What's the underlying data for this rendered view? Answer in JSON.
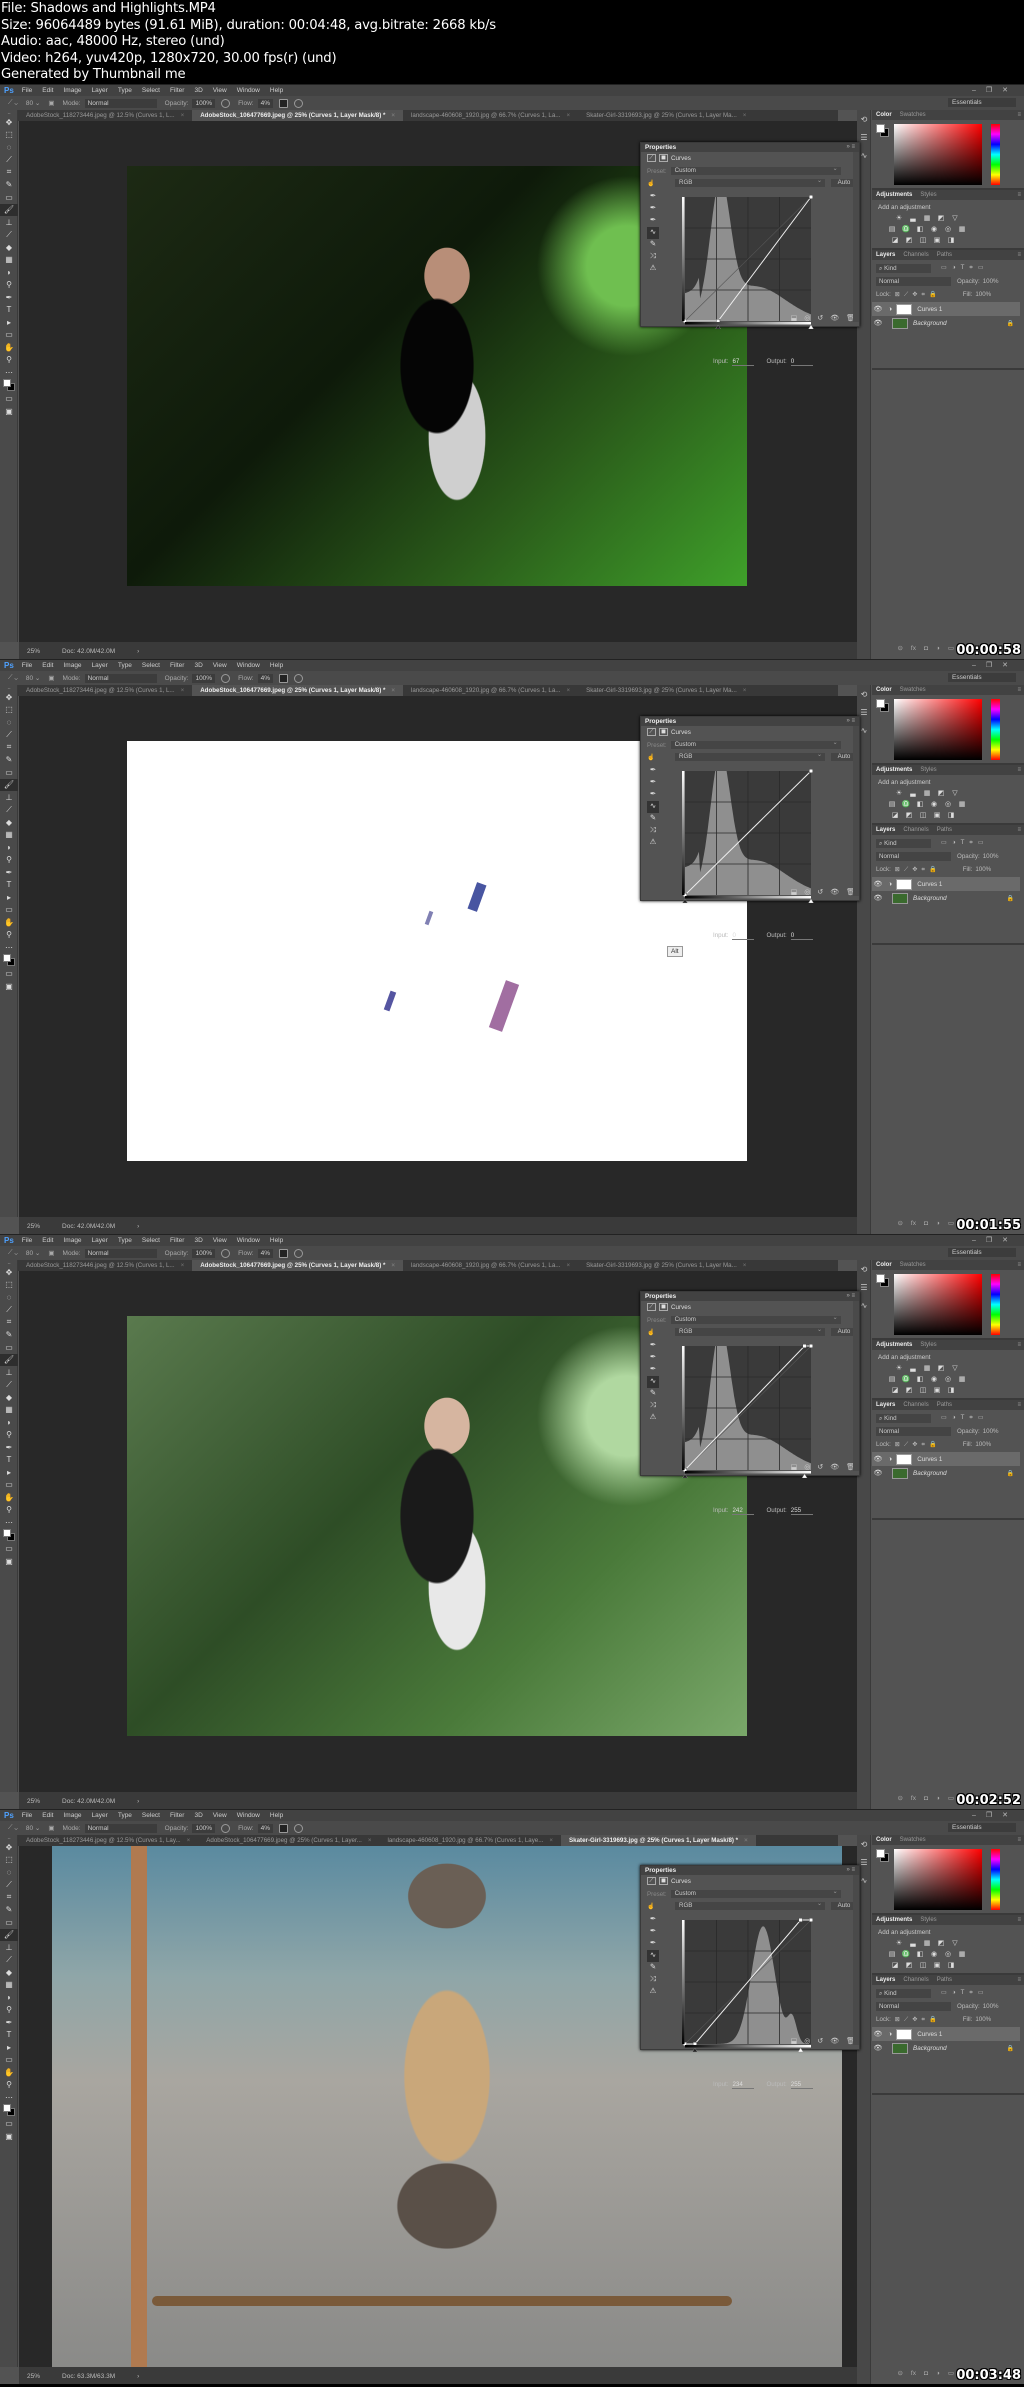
{
  "header": {
    "lines": [
      "File: Shadows and Highlights.MP4",
      "Size: 96064489 bytes (91.61 MiB), duration: 00:04:48, avg.bitrate: 2668 kb/s",
      "Audio: aac, 48000 Hz, stereo (und)",
      "Video: h264, yuv420p, 1280x720, 30.00 fps(r) (und)",
      "Generated by Thumbnail me"
    ]
  },
  "app": {
    "logo": "Ps",
    "menu": [
      "File",
      "Edit",
      "Image",
      "Layer",
      "Type",
      "Select",
      "Filter",
      "3D",
      "View",
      "Window",
      "Help"
    ],
    "window_controls": [
      "–",
      "❐",
      "✕"
    ],
    "workspace": "Essentials",
    "options": {
      "mode_label": "Mode:",
      "mode_value": "Normal",
      "opacity_label": "Opacity:",
      "opacity_value": "100%",
      "flow_label": "Flow:",
      "flow_value": "4%",
      "brush_size": "80"
    },
    "tools": [
      "✥",
      "⬚",
      "◌",
      "⟋",
      "⌗",
      "✎",
      "▭",
      "🖌",
      "⊥",
      "⟋",
      "◆",
      "▦",
      "◗",
      "⚲",
      "✒",
      "T",
      "▸",
      "▭",
      "✋",
      "⚲",
      "⋯"
    ],
    "color_panel": {
      "tabs": [
        "Color",
        "Swatches"
      ]
    },
    "adjustments_panel": {
      "tabs": [
        "Adjustments",
        "Styles"
      ],
      "title": "Add an adjustment",
      "rows": [
        [
          "☀",
          "▃",
          "▦",
          "◩",
          "▽"
        ],
        [
          "▤",
          "♎",
          "◧",
          "◉",
          "◎",
          "▦"
        ],
        [
          "◪",
          "◩",
          "◫",
          "▣",
          "◨"
        ]
      ]
    },
    "layers_panel": {
      "tabs": [
        "Layers",
        "Channels",
        "Paths"
      ],
      "filter_label": "⌕ Kind",
      "blend_mode": "Normal",
      "opacity_label": "Opacity:",
      "opacity_value": "100%",
      "lock_label": "Lock:",
      "fill_label": "Fill:",
      "fill_value": "100%",
      "layers": [
        {
          "name": "Curves 1",
          "selected": true
        },
        {
          "name": "Background",
          "selected": false
        }
      ],
      "footer_icons": [
        "⊝",
        "fx",
        "◘",
        "◑",
        "▭"
      ]
    }
  },
  "frames": [
    {
      "timestamp": "00:00:58",
      "tabs": [
        {
          "label": "AdobeStock_118273446.jpeg @ 12.5% (Curves 1, L...",
          "active": false
        },
        {
          "label": "AdobeStock_106477669.jpeg @ 25% (Curves 1, Layer Mask/8) *",
          "active": true
        },
        {
          "label": "landscape-460608_1920.jpg @ 66.7% (Curves 1, La...",
          "active": false
        },
        {
          "label": "Skater-Girl-3319693.jpg @ 25% (Curves 1, Layer Ma...",
          "active": false
        }
      ],
      "zoom": "25%",
      "doc_size": "Doc: 42.0M/42.0M",
      "image": "forest",
      "curves": {
        "title": "Properties",
        "type_label": "Curves",
        "preset_label": "Preset:",
        "preset_value": "Custom",
        "channel": "RGB",
        "auto_label": "Auto",
        "input_label": "Input:",
        "input_value": "67",
        "output_label": "Output:",
        "output_value": "0",
        "curve_points": [
          [
            0,
            0
          ],
          [
            67,
            0
          ],
          [
            255,
            255
          ]
        ],
        "histogram": "forest"
      }
    },
    {
      "timestamp": "00:01:55",
      "tabs": [
        {
          "label": "AdobeStock_118273446.jpeg @ 12.5% (Curves 1, L...",
          "active": false
        },
        {
          "label": "AdobeStock_106477669.jpeg @ 25% (Curves 1, Layer Mask/8) *",
          "active": true
        },
        {
          "label": "landscape-460608_1920.jpg @ 66.7% (Curves 1, La...",
          "active": false
        },
        {
          "label": "Skater-Girl-3319693.jpg @ 25% (Curves 1, Layer Ma...",
          "active": false
        }
      ],
      "zoom": "25%",
      "doc_size": "Doc: 42.0M/42.0M",
      "image": "clipping-white",
      "alt_tag": "Alt",
      "curves": {
        "title": "Properties",
        "type_label": "Curves",
        "preset_label": "Preset:",
        "preset_value": "Custom",
        "channel": "RGB",
        "auto_label": "Auto",
        "input_label": "Input:",
        "input_value": "0",
        "output_label": "Output:",
        "output_value": "0",
        "curve_points": [
          [
            0,
            0
          ],
          [
            255,
            255
          ]
        ],
        "histogram": "forest"
      }
    },
    {
      "timestamp": "00:02:52",
      "tabs": [
        {
          "label": "AdobeStock_118273446.jpeg @ 12.5% (Curves 1, L...",
          "active": false
        },
        {
          "label": "AdobeStock_106477669.jpeg @ 25% (Curves 1, Layer Mask/8) *",
          "active": true
        },
        {
          "label": "landscape-460608_1920.jpg @ 66.7% (Curves 1, La...",
          "active": false
        },
        {
          "label": "Skater-Girl-3319693.jpg @ 25% (Curves 1, Layer Ma...",
          "active": false
        }
      ],
      "zoom": "25%",
      "doc_size": "Doc: 42.0M/42.0M",
      "image": "forest-bright",
      "curves": {
        "title": "Properties",
        "type_label": "Curves",
        "preset_label": "Preset:",
        "preset_value": "Custom",
        "channel": "RGB",
        "auto_label": "Auto",
        "input_label": "Input:",
        "input_value": "242",
        "output_label": "Output:",
        "output_value": "255",
        "curve_points": [
          [
            0,
            0
          ],
          [
            242,
            255
          ],
          [
            255,
            255
          ]
        ],
        "histogram": "forest"
      }
    },
    {
      "timestamp": "00:03:48",
      "tabs": [
        {
          "label": "AdobeStock_118273446.jpeg @ 12.5% (Curves 1, Lay...",
          "active": false
        },
        {
          "label": "AdobeStock_106477669.jpeg @ 25% (Curves 1, Layer...",
          "active": false
        },
        {
          "label": "landscape-460608_1920.jpg @ 66.7% (Curves 1, Laye...",
          "active": false
        },
        {
          "label": "Skater-Girl-3319693.jpg @ 25% (Curves 1, Layer Mask/8) *",
          "active": true
        }
      ],
      "zoom": "25%",
      "doc_size": "Doc: 63.3M/63.3M",
      "image": "skater",
      "curves": {
        "title": "Properties",
        "type_label": "Curves",
        "preset_label": "Preset:",
        "preset_value": "Custom",
        "channel": "RGB",
        "auto_label": "Auto",
        "input_label": "Input:",
        "input_value": "234",
        "output_label": "Output:",
        "output_value": "255",
        "curve_points": [
          [
            0,
            0
          ],
          [
            20,
            0
          ],
          [
            234,
            255
          ],
          [
            255,
            255
          ]
        ],
        "histogram": "skater"
      }
    }
  ]
}
